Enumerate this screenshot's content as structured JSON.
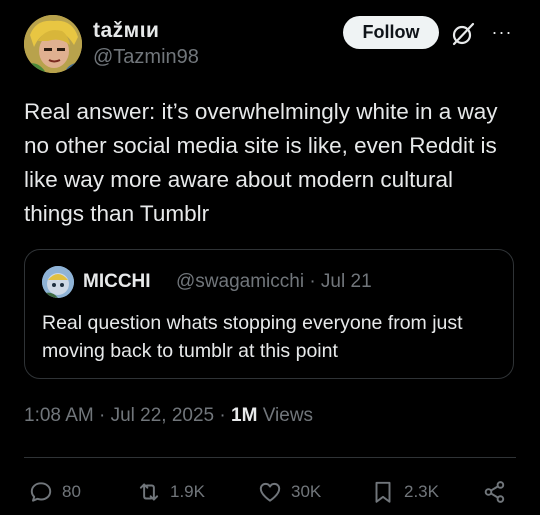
{
  "author": {
    "display_name": "tažмιи",
    "handle": "@Tazmin98",
    "follow_label": "Follow"
  },
  "more_label": "···",
  "post": {
    "text": "Real answer: it’s overwhelmingly white in a way no other social media site is like, even Reddit is like way more aware about modern cultural things than Tumblr"
  },
  "quoted": {
    "display_name": "MICCHI",
    "handle_date": "@swagamicchi · Jul 21",
    "text": "Real question whats stopping everyone from just moving back to tumblr at this point"
  },
  "meta": {
    "timestamp": "1:08 AM · Jul 22, 2025 · ",
    "views_count": "1M",
    "views_label": " Views"
  },
  "actions": {
    "replies": "80",
    "reposts": "1.9K",
    "likes": "30K",
    "bookmarks": "2.3K"
  },
  "colors": {
    "background": "#000000",
    "text": "#e7e9ea",
    "muted": "#71767b",
    "border": "#2f3336"
  }
}
